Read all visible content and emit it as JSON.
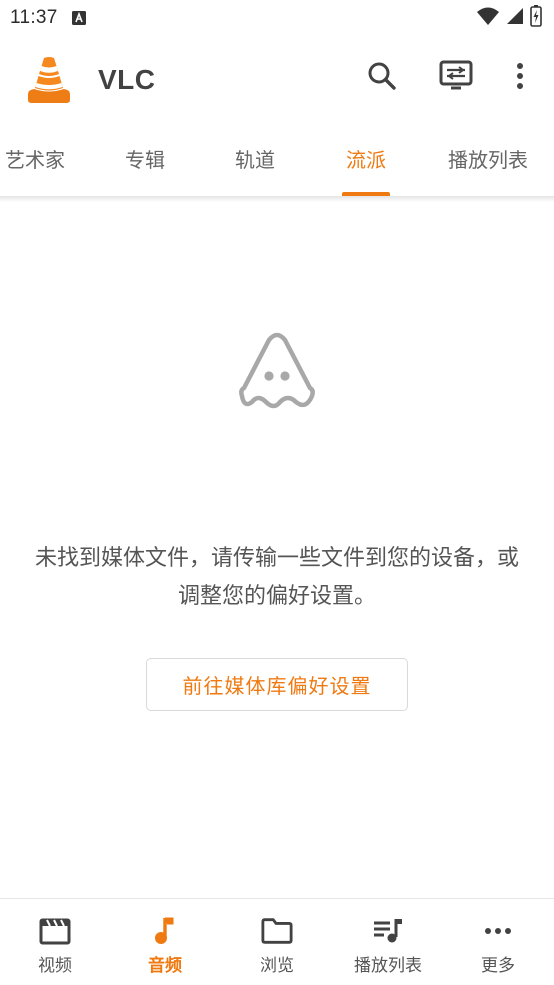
{
  "status_bar": {
    "time": "11:37",
    "notification_icon": "a-icon",
    "icons": [
      "wifi-icon",
      "signal-icon",
      "battery-icon"
    ]
  },
  "app_bar": {
    "title": "VLC",
    "logo": "vlc-cone-logo",
    "actions": [
      "search-icon",
      "cast-renderer-icon",
      "more-vert-icon"
    ]
  },
  "tabs": [
    {
      "label": "艺术家",
      "active": false
    },
    {
      "label": "专辑",
      "active": false
    },
    {
      "label": "轨道",
      "active": false
    },
    {
      "label": "流派",
      "active": true
    },
    {
      "label": "播放列表",
      "active": false
    }
  ],
  "empty_state": {
    "icon": "ghost-cone-icon",
    "message": "未找到媒体文件，请传输一些文件到您的设备，或调整您的偏好设置。",
    "button_label": "前往媒体库偏好设置"
  },
  "bottom_nav": [
    {
      "label": "视频",
      "icon": "video-clapper-icon",
      "active": false
    },
    {
      "label": "音频",
      "icon": "music-note-icon",
      "active": true
    },
    {
      "label": "浏览",
      "icon": "folder-icon",
      "active": false
    },
    {
      "label": "播放列表",
      "icon": "playlist-icon",
      "active": false
    },
    {
      "label": "更多",
      "icon": "more-horiz-icon",
      "active": false
    }
  ],
  "colors": {
    "accent": "#f07a12",
    "text": "#555555",
    "icon": "#424242"
  }
}
